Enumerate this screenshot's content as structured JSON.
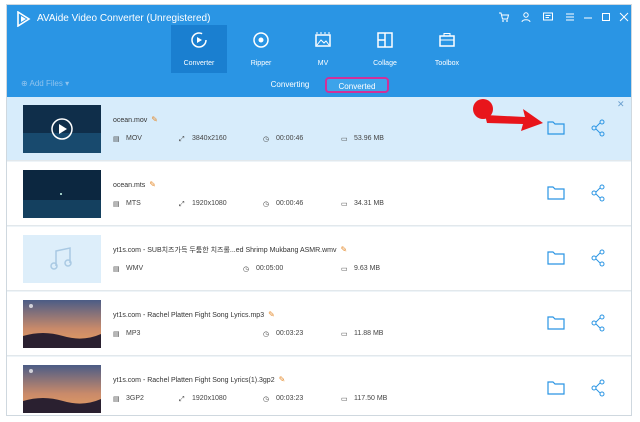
{
  "window": {
    "title": "AVAide Video Converter (Unregistered)"
  },
  "nav": [
    {
      "label": "Converter",
      "icon": "converter-icon",
      "active": true
    },
    {
      "label": "Ripper",
      "icon": "ripper-icon",
      "active": false
    },
    {
      "label": "MV",
      "icon": "mv-icon",
      "active": false
    },
    {
      "label": "Collage",
      "icon": "collage-icon",
      "active": false
    },
    {
      "label": "Toolbox",
      "icon": "toolbox-icon",
      "active": false
    }
  ],
  "toolbar": {
    "add_files": "Add Files",
    "tabs": [
      "Converting",
      "Converted"
    ],
    "active_tab": "Converted"
  },
  "files": [
    {
      "name": "ocean.mov",
      "format": "MOV",
      "resolution": "3840x2160",
      "duration": "00:00:46",
      "size": "53.96 MB",
      "thumbnail": "ocean-video-playing",
      "selected": true
    },
    {
      "name": "ocean.mts",
      "format": "MTS",
      "resolution": "1920x1080",
      "duration": "00:00:46",
      "size": "34.31 MB",
      "thumbnail": "ocean-video",
      "selected": false
    },
    {
      "name": "yt1s.com - SUB치즈가득 두툼한 치즈롤...ed Shrimp Mukbang ASMR.wmv",
      "format": "WMV",
      "resolution": "",
      "duration": "00:05:00",
      "size": "9.63 MB",
      "thumbnail": "audio-note",
      "selected": false
    },
    {
      "name": "yt1s.com - Rachel Platten  Fight Song Lyrics.mp3",
      "format": "MP3",
      "resolution": "",
      "duration": "00:03:23",
      "size": "11.88 MB",
      "thumbnail": "sunset",
      "selected": false
    },
    {
      "name": "yt1s.com - Rachel Platten  Fight Song Lyrics(1).3gp2",
      "format": "3GP2",
      "resolution": "1920x1080",
      "duration": "00:03:23",
      "size": "117.50 MB",
      "thumbnail": "sunset",
      "selected": false
    }
  ],
  "colors": {
    "titlebar": "#2a95e4",
    "nav_active": "#1a7fd0",
    "selected_row": "#d7ecfb",
    "highlight": "#d0309a",
    "arrow": "#e8151b"
  }
}
